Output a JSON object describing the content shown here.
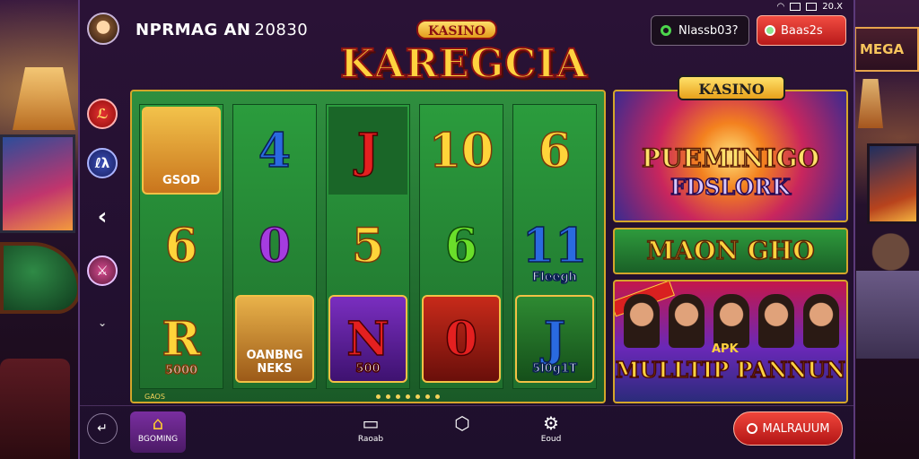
{
  "status_bar": {
    "icons": [
      "wifi-icon",
      "grid-icon",
      "battery-icon"
    ],
    "label": "20.X"
  },
  "header": {
    "title": "NPRMAG AN",
    "title_number": "20830",
    "status_pill_label": "Nlassb03?",
    "top_button_label": "Baas2s"
  },
  "logo": {
    "sub": "KASINO",
    "main": "KAREGCIA"
  },
  "rail": {
    "btn1": "ℒ",
    "btn2": "ℓλ",
    "btn3": "‹",
    "btn4": "⚔",
    "btn5": "⌄"
  },
  "reels": [
    {
      "syms": [
        {
          "glyph": "",
          "caption": "GSOD",
          "style": "tile-photo"
        },
        {
          "glyph": "6",
          "caption": "",
          "style": "gold"
        },
        {
          "glyph": "R",
          "caption": "5000",
          "style": "gold"
        }
      ]
    },
    {
      "syms": [
        {
          "glyph": "4",
          "caption": "",
          "style": "blue"
        },
        {
          "glyph": "0",
          "caption": "",
          "style": "purple"
        },
        {
          "glyph": "",
          "caption": "OANBNG NEKS",
          "style": "tile-photo2"
        }
      ]
    },
    {
      "syms": [
        {
          "glyph": "J",
          "caption": "",
          "style": "red"
        },
        {
          "glyph": "5",
          "caption": "",
          "style": "gold"
        },
        {
          "glyph": "N",
          "caption": "500",
          "style": "tile-purple"
        }
      ]
    },
    {
      "syms": [
        {
          "glyph": "10",
          "caption": "",
          "style": "gold"
        },
        {
          "glyph": "6",
          "caption": "",
          "style": "green"
        },
        {
          "glyph": "0",
          "caption": "",
          "style": "tile-red"
        }
      ]
    },
    {
      "syms": [
        {
          "glyph": "6",
          "caption": "",
          "style": "gold"
        },
        {
          "glyph": "11",
          "caption": "Fleegh",
          "style": "blue"
        },
        {
          "glyph": "J",
          "caption": "5l0g1T",
          "style": "tile-green"
        }
      ]
    }
  ],
  "slot_footer": "GAOS",
  "promos": {
    "promo1": {
      "badge": "KASINO",
      "line1": "PUEMINIGO",
      "line2": "FDSLORK"
    },
    "promo2": {
      "label": "MAON GHO"
    },
    "promo3": {
      "apk": "APK",
      "title": "MULLTIP PANNUN"
    }
  },
  "bottom_nav": {
    "side_icon": "↵",
    "items": [
      {
        "label": "BGOMING",
        "icon": "⌂"
      },
      {
        "label": "Raoab",
        "icon": "▭"
      },
      {
        "label": "",
        "icon": "⬡"
      },
      {
        "label": "Eoud",
        "icon": "⚙"
      }
    ],
    "cta_label": "MALRAUUM"
  },
  "colors": {
    "accent_gold": "#ffd23f",
    "accent_red": "#e42020",
    "felt_green": "#2b9c3d",
    "frame_purple": "#2a1236"
  }
}
